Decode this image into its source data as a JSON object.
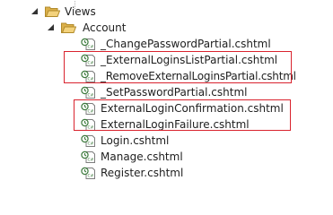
{
  "tree": {
    "views_folder": "Views",
    "account_folder": "Account",
    "files": [
      "_ChangePasswordPartial.cshtml",
      "_ExternalLoginsListPartial.cshtml",
      "_RemoveExternalLoginsPartial.cshtml",
      "_SetPasswordPartial.cshtml",
      "ExternalLoginConfirmation.cshtml",
      "ExternalLoginFailure.cshtml",
      "Login.cshtml",
      "Manage.cshtml",
      "Register.cshtml"
    ]
  },
  "colors": {
    "highlight_border": "#d9232e",
    "folder": "#e8c15c"
  },
  "icons": {
    "expander": "expanded-triangle-icon",
    "folder": "folder-open-icon",
    "file": "cshtml-file-icon"
  }
}
